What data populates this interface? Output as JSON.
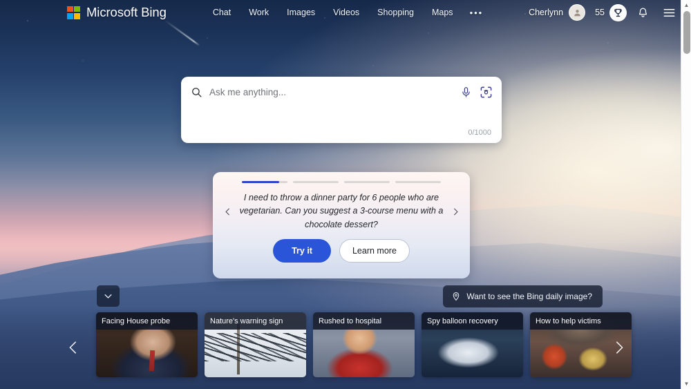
{
  "header": {
    "brand": "Microsoft Bing",
    "logo_icon": "microsoft-squares-logo",
    "logo_colors": {
      "top_left": "#f25022",
      "top_right": "#7fba00",
      "bottom_left": "#00a4ef",
      "bottom_right": "#ffb900"
    },
    "nav": [
      {
        "label": "Chat",
        "name": "nav-chat"
      },
      {
        "label": "Work",
        "name": "nav-work"
      },
      {
        "label": "Images",
        "name": "nav-images"
      },
      {
        "label": "Videos",
        "name": "nav-videos"
      },
      {
        "label": "Shopping",
        "name": "nav-shopping"
      },
      {
        "label": "Maps",
        "name": "nav-maps"
      }
    ],
    "more_label": "•••",
    "user_name": "Cherlynn",
    "avatar_icon": "person-avatar-icon",
    "rewards_count": "55",
    "rewards_icon": "trophy-icon",
    "notifications_icon": "bell-icon",
    "menu_icon": "hamburger-menu-icon"
  },
  "search": {
    "placeholder": "Ask me anything...",
    "value": "",
    "search_icon": "search-icon",
    "mic_icon": "microphone-icon",
    "visual_search_icon": "visual-search-camera-icon",
    "counter": "0/1000"
  },
  "prompt_card": {
    "progress": [
      {
        "filled_percent": 82
      },
      {
        "filled_percent": 0
      },
      {
        "filled_percent": 0
      },
      {
        "filled_percent": 0
      }
    ],
    "prev_icon": "chevron-left-icon",
    "next_icon": "chevron-right-icon",
    "text": "I need to throw a dinner party for 6 people who are vegetarian. Can you suggest a 3-course menu with a chocolate dessert?",
    "primary_label": "Try it",
    "secondary_label": "Learn more",
    "primary_color": "#2b55d8"
  },
  "daily_image_pill": {
    "label": "Want to see the Bing daily image?",
    "icon": "location-pin-icon"
  },
  "expand_button": {
    "icon": "chevron-down-icon"
  },
  "news": {
    "prev_icon": "chevron-left-icon",
    "next_icon": "chevron-right-icon",
    "cards": [
      {
        "title": "Facing House probe"
      },
      {
        "title": "Nature's warning sign"
      },
      {
        "title": "Rushed to hospital"
      },
      {
        "title": "Spy balloon recovery"
      },
      {
        "title": "How to help victims"
      }
    ]
  },
  "scrollbar": {
    "up_icon": "scroll-up-arrow-icon",
    "down_icon": "scroll-down-arrow-icon",
    "up_glyph": "▲",
    "down_glyph": "▼"
  }
}
